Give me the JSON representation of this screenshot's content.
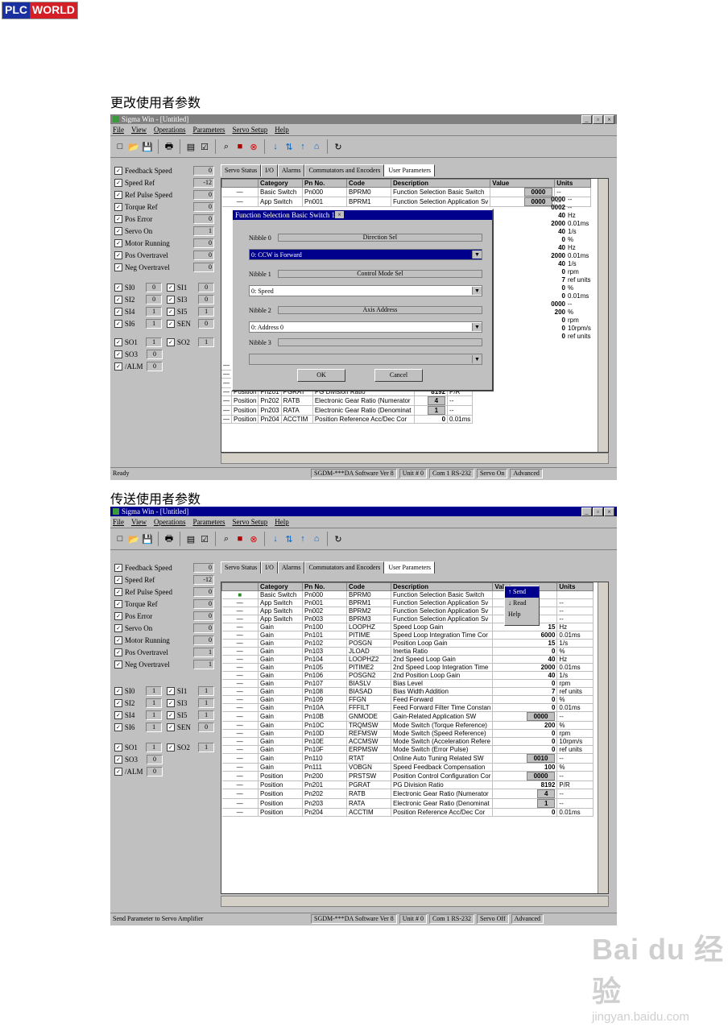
{
  "logo": {
    "left": "PLC",
    "right": "WORLD"
  },
  "headings": [
    "更改使用者参数",
    "传送使用者参数"
  ],
  "menu": [
    "File",
    "View",
    "Operations",
    "Parameters",
    "Servo Setup",
    "Help"
  ],
  "left_panel": [
    {
      "label": "Feedback Speed",
      "value": "0"
    },
    {
      "label": "Speed Ref",
      "value": "-12"
    },
    {
      "label": "Ref Pulse Speed",
      "value": "0"
    },
    {
      "label": "Torque Ref",
      "value": "0"
    },
    {
      "label": "Pos Error",
      "value": "0"
    },
    {
      "label": "Servo On",
      "value": "1"
    },
    {
      "label": "Motor Running",
      "value": "0"
    },
    {
      "label": "Pos Overtravel",
      "value": "0"
    },
    {
      "label": "Neg Overtravel",
      "value": "0"
    }
  ],
  "left_panel_2": [
    {
      "label": "Feedback Speed",
      "value": "0"
    },
    {
      "label": "Speed Ref",
      "value": "-12"
    },
    {
      "label": "Ref Pulse Speed",
      "value": "0"
    },
    {
      "label": "Torque Ref",
      "value": "0"
    },
    {
      "label": "Pos Error",
      "value": "0"
    },
    {
      "label": "Servo On",
      "value": "0"
    },
    {
      "label": "Motor Running",
      "value": "0"
    },
    {
      "label": "Pos Overtravel",
      "value": "1"
    },
    {
      "label": "Neg Overtravel",
      "value": "1"
    }
  ],
  "io_top": [
    [
      {
        "n": "SI0",
        "v": "0"
      },
      {
        "n": "SI1",
        "v": "0"
      }
    ],
    [
      {
        "n": "SI2",
        "v": "0"
      },
      {
        "n": "SI3",
        "v": "0"
      }
    ],
    [
      {
        "n": "SI4",
        "v": "1"
      },
      {
        "n": "SI5",
        "v": "1"
      }
    ],
    [
      {
        "n": "SI6",
        "v": "1"
      },
      {
        "n": "SEN",
        "v": "0"
      }
    ]
  ],
  "io_top_2": [
    [
      {
        "n": "SI0",
        "v": "1"
      },
      {
        "n": "SI1",
        "v": "1"
      }
    ],
    [
      {
        "n": "SI2",
        "v": "1"
      },
      {
        "n": "SI3",
        "v": "1"
      }
    ],
    [
      {
        "n": "SI4",
        "v": "1"
      },
      {
        "n": "SI5",
        "v": "1"
      }
    ],
    [
      {
        "n": "SI6",
        "v": "1"
      },
      {
        "n": "SEN",
        "v": "0"
      }
    ]
  ],
  "io_out": [
    {
      "n": "SO1",
      "v": "1"
    },
    {
      "n": "SO2",
      "v": "1"
    }
  ],
  "io_single": [
    {
      "n": "SO3",
      "v": "0"
    },
    {
      "n": "/ALM",
      "v": "0"
    }
  ],
  "tabs": [
    "Servo Status",
    "I/O",
    "Alarms",
    "Commutators and Encoders",
    "User Parameters"
  ],
  "columns": [
    "Category",
    "Pn No.",
    "Code",
    "Description",
    "Value",
    "Units"
  ],
  "rows_bottom_1": [
    [
      "—",
      "Gain",
      "Pn110",
      "RTAT",
      "Online Auto Tuning Related SW",
      "0010",
      ""
    ],
    [
      "—",
      "Gain",
      "Pn111",
      "VOBGN",
      "Speed Feedback Compensation",
      "100",
      "%"
    ],
    [
      "—",
      "Position",
      "Pn200",
      "PRSTSW",
      "Position Control Configuration Cor",
      "0000",
      "--"
    ],
    [
      "—",
      "Position",
      "Pn201",
      "PGRAT",
      "PG Division Ratio",
      "8192",
      "P/R"
    ],
    [
      "—",
      "Position",
      "Pn202",
      "RATB",
      "Electronic Gear Ratio (Numerator",
      "4",
      "--"
    ],
    [
      "—",
      "Position",
      "Pn203",
      "RATA",
      "Electronic Gear Ratio (Denominat",
      "1",
      "--"
    ],
    [
      "—",
      "Position",
      "Pn204",
      "ACCTIM",
      "Position Reference Acc/Dec Cor",
      "0",
      "0.01ms"
    ]
  ],
  "rows_top_1": [
    [
      "—",
      "Basic Switch",
      "Pn000",
      "BPRM0",
      "Function Selection Basic Switch",
      "0000",
      "--"
    ],
    [
      "—",
      "App Switch",
      "Pn001",
      "BPRM1",
      "Function Selection Application Sv",
      "0000",
      "--"
    ]
  ],
  "rows_2": [
    [
      "■",
      "Basic Switch",
      "Pn000",
      "BPRM0",
      "Function Selection Basic Switch",
      "",
      ""
    ],
    [
      "—",
      "App Switch",
      "Pn001",
      "BPRM1",
      "Function Selection Application Sv",
      "",
      "--"
    ],
    [
      "—",
      "App Switch",
      "Pn002",
      "BPRM2",
      "Function Selection Application Sv",
      "",
      "--"
    ],
    [
      "—",
      "App Switch",
      "Pn003",
      "BPRM3",
      "Function Selection Application Sv",
      "",
      "--"
    ],
    [
      "—",
      "Gain",
      "Pn100",
      "LOOPHZ",
      "Speed Loop Gain",
      "15",
      "Hz"
    ],
    [
      "—",
      "Gain",
      "Pn101",
      "PITIME",
      "Speed Loop Integration Time Cor",
      "6000",
      "0.01ms"
    ],
    [
      "—",
      "Gain",
      "Pn102",
      "POSGN",
      "Position Loop Gain",
      "15",
      "1/s"
    ],
    [
      "—",
      "Gain",
      "Pn103",
      "JLOAD",
      "Inertia Ratio",
      "0",
      "%"
    ],
    [
      "—",
      "Gain",
      "Pn104",
      "LOOPHZ2",
      "2nd Speed Loop Gain",
      "40",
      "Hz"
    ],
    [
      "—",
      "Gain",
      "Pn105",
      "PITIME2",
      "2nd Speed Loop Integration Time",
      "2000",
      "0.01ms"
    ],
    [
      "—",
      "Gain",
      "Pn106",
      "POSGN2",
      "2nd Position Loop Gain",
      "40",
      "1/s"
    ],
    [
      "—",
      "Gain",
      "Pn107",
      "BIASLV",
      "Bias Level",
      "0",
      "rpm"
    ],
    [
      "—",
      "Gain",
      "Pn108",
      "BIASAD",
      "Bias Width Addition",
      "7",
      "ref units"
    ],
    [
      "—",
      "Gain",
      "Pn109",
      "FFGN",
      "Feed Forward",
      "0",
      "%"
    ],
    [
      "—",
      "Gain",
      "Pn10A",
      "FFFILT",
      "Feed Forward Filter Time Constan",
      "0",
      "0.01ms"
    ],
    [
      "—",
      "Gain",
      "Pn10B",
      "GNMODE",
      "Gain-Related Application SW",
      "0000",
      "--"
    ],
    [
      "—",
      "Gain",
      "Pn10C",
      "TRQMSW",
      "Mode Switch (Torque Reference)",
      "200",
      "%"
    ],
    [
      "—",
      "Gain",
      "Pn10D",
      "REFMSW",
      "Mode Switch (Speed Reference)",
      "0",
      "rpm"
    ],
    [
      "—",
      "Gain",
      "Pn10E",
      "ACCMSW",
      "Mode Switch (Acceleration Refere",
      "0",
      "10rpm/s"
    ],
    [
      "—",
      "Gain",
      "Pn10F",
      "ERPMSW",
      "Mode Switch (Error Pulse)",
      "0",
      "ref units"
    ],
    [
      "—",
      "Gain",
      "Pn110",
      "RTAT",
      "Online Auto Tuning Related SW",
      "0010",
      "--"
    ],
    [
      "—",
      "Gain",
      "Pn111",
      "VOBGN",
      "Speed Feedback Compensation",
      "100",
      "%"
    ],
    [
      "—",
      "Position",
      "Pn200",
      "PRSTSW",
      "Position Control Configuration Cor",
      "0000",
      "--"
    ],
    [
      "—",
      "Position",
      "Pn201",
      "PGRAT",
      "PG Division Ratio",
      "8192",
      "P/R"
    ],
    [
      "—",
      "Position",
      "Pn202",
      "RATB",
      "Electronic Gear Ratio (Numerator",
      "4",
      "--"
    ],
    [
      "—",
      "Position",
      "Pn203",
      "RATA",
      "Electronic Gear Ratio (Denominat",
      "1",
      "--"
    ],
    [
      "—",
      "Position",
      "Pn204",
      "ACCTIM",
      "Position Reference Acc/Dec Cor",
      "0",
      "0.01ms"
    ]
  ],
  "right_col_partial": [
    {
      "v": "0000",
      "u": "--"
    },
    {
      "v": "0002",
      "u": "--"
    },
    {
      "v": "40",
      "u": "Hz"
    },
    {
      "v": "2000",
      "u": "0.01ms"
    },
    {
      "v": "40",
      "u": "1/s"
    },
    {
      "v": "0",
      "u": "%"
    },
    {
      "v": "40",
      "u": "Hz"
    },
    {
      "v": "2000",
      "u": "0.01ms"
    },
    {
      "v": "40",
      "u": "1/s"
    },
    {
      "v": "0",
      "u": "rpm"
    },
    {
      "v": "7",
      "u": "ref units"
    },
    {
      "v": "0",
      "u": "%"
    },
    {
      "v": "0",
      "u": "0.01ms"
    },
    {
      "v": "0000",
      "u": "--"
    },
    {
      "v": "200",
      "u": "%"
    },
    {
      "v": "0",
      "u": "rpm"
    },
    {
      "v": "0",
      "u": "10rpm/s"
    },
    {
      "v": "0",
      "u": "ref units"
    }
  ],
  "dialog": {
    "title": "Function Selection Basic Switch 1",
    "nibbles": [
      {
        "label": "Nibble 0",
        "bar": "Direction Sel",
        "value": "0: CCW is Forward"
      },
      {
        "label": "Nibble 1",
        "bar": "Control Mode Sel",
        "value": "0: Speed"
      },
      {
        "label": "Nibble 2",
        "bar": "Axis Address",
        "value": "0: Address 0"
      },
      {
        "label": "Nibble 3",
        "bar": "",
        "value": ""
      }
    ],
    "ok": "OK",
    "cancel": "Cancel"
  },
  "context_menu": {
    "send": "Send",
    "read": "Read",
    "help": "Help"
  },
  "status1": [
    "Ready",
    "SGDM-***DA Software Ver 8",
    "Unit # 0",
    "Com 1 RS-232",
    "Servo On",
    "Advanced"
  ],
  "status2": [
    "Send Parameter to Servo Amplifier",
    "SGDM-***DA Software Ver 8",
    "Unit # 0",
    "Com 1 RS-232",
    "Servo Off",
    "Advanced"
  ],
  "watermark": {
    "brand": "Bai du 经验",
    "url": "jingyan.baidu.com"
  },
  "colors": {
    "title_active": "#00008c",
    "title_inactive": "#808080",
    "window_bg": "#c0c0c0"
  }
}
